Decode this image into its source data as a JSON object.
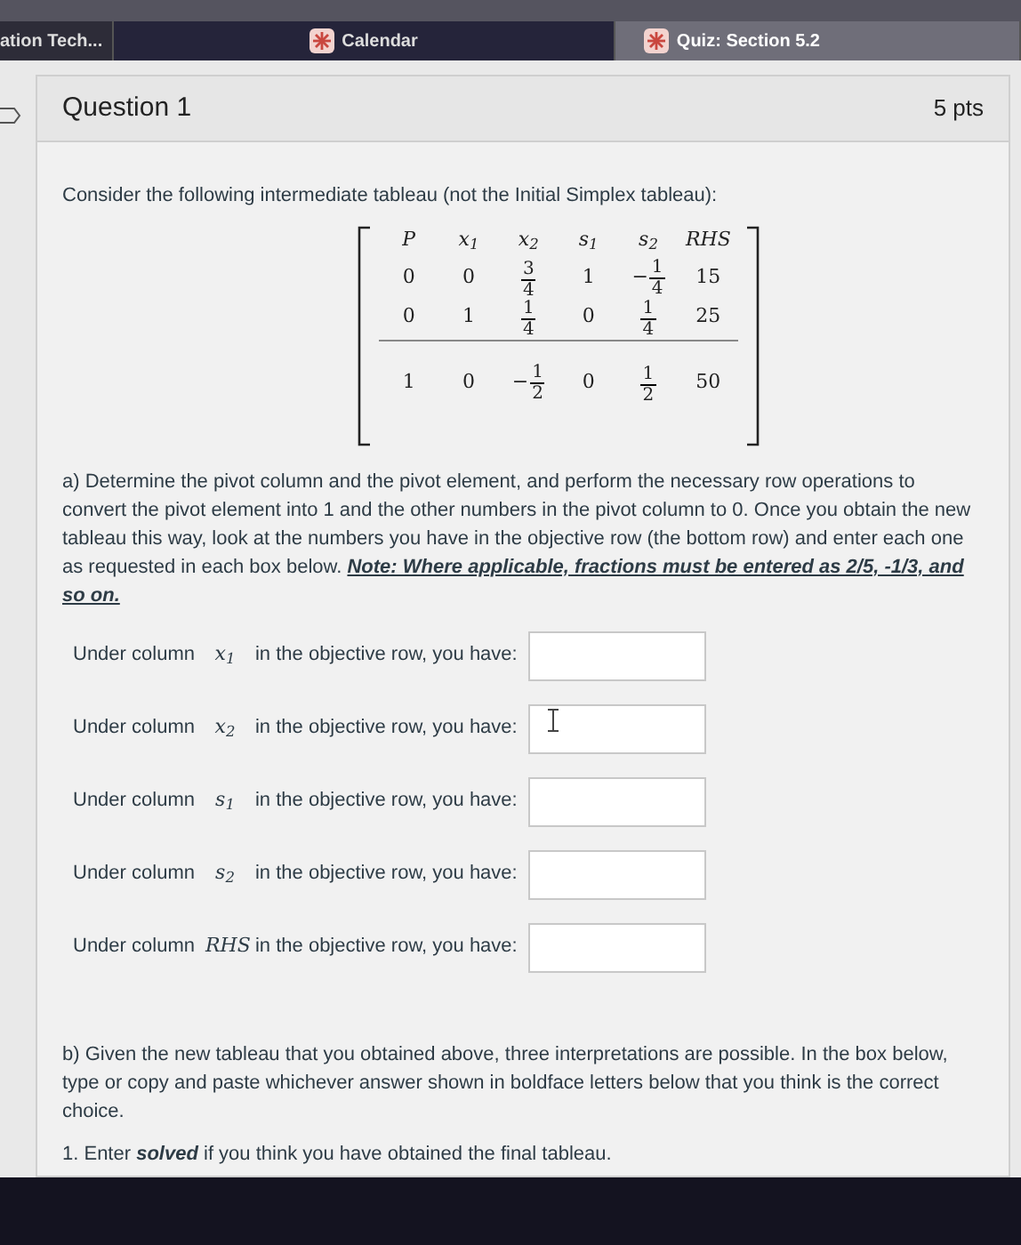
{
  "browser_tabs": [
    {
      "label": "ation Tech...",
      "selected": false,
      "icon": false
    },
    {
      "label": "Calendar",
      "selected": false,
      "icon": true
    },
    {
      "label": "Quiz: Section 5.2",
      "selected": true,
      "icon": true
    }
  ],
  "question": {
    "title": "Question 1",
    "points": "5 pts",
    "intro": "Consider the following intermediate tableau (not the Initial Simplex tableau):",
    "tableau": {
      "headers": [
        "P",
        "x$_{1}$",
        "x$_{2}$",
        "s$_{1}$",
        "s$_{2}$",
        "RHS"
      ],
      "rows": [
        [
          {
            "kind": "number",
            "text": "0"
          },
          {
            "kind": "number",
            "text": "0"
          },
          {
            "kind": "fraction",
            "numerator": "3",
            "denominator": "4"
          },
          {
            "kind": "number",
            "text": "1"
          },
          {
            "kind": "fraction",
            "sign": "−",
            "numerator": "1",
            "denominator": "4"
          },
          {
            "kind": "number",
            "text": "15"
          }
        ],
        [
          {
            "kind": "number",
            "text": "0"
          },
          {
            "kind": "number",
            "text": "1"
          },
          {
            "kind": "fraction",
            "numerator": "1",
            "denominator": "4"
          },
          {
            "kind": "number",
            "text": "0"
          },
          {
            "kind": "fraction",
            "numerator": "1",
            "denominator": "4"
          },
          {
            "kind": "number",
            "text": "25"
          }
        ]
      ],
      "objective_row": [
        {
          "kind": "number",
          "text": "1"
        },
        {
          "kind": "number",
          "text": "0"
        },
        {
          "kind": "fraction",
          "sign": "−",
          "numerator": "1",
          "denominator": "2"
        },
        {
          "kind": "number",
          "text": "0"
        },
        {
          "kind": "fraction",
          "numerator": "1",
          "denominator": "2"
        },
        {
          "kind": "number",
          "text": "50"
        }
      ]
    },
    "part_a": "a) Determine the pivot column and the pivot element, and perform the necessary row operations to convert the pivot element into 1 and the other numbers in the pivot column to 0. Once you obtain the new tableau this way, look at the numbers you have in the objective row (the bottom row) and enter each one as requested in each box below.",
    "part_a_note": "Note: Where applicable, fractions must be entered as 2/5,  -1/3, and so on.",
    "answers": [
      {
        "prefix": "Under column",
        "variable": "x$_{1}$",
        "suffix": "in the objective row, you have:",
        "cursor": false
      },
      {
        "prefix": "Under column",
        "variable": "x$_{2}$",
        "suffix": "in the objective row, you have:",
        "cursor": true
      },
      {
        "prefix": "Under column",
        "variable": "s$_{1}$",
        "suffix": "in the objective row, you have:",
        "cursor": false
      },
      {
        "prefix": "Under column",
        "variable": "s$_{2}$",
        "suffix": "in the objective row, you have:",
        "cursor": false
      },
      {
        "prefix": "Under column",
        "variable": "RHS",
        "suffix": "in the objective row, you have:",
        "cursor": false
      }
    ],
    "part_b": "b) Given the new tableau that you obtained above, three interpretations are possible. In the box below, type or copy and paste whichever answer shown in boldface letters below that you think is the correct choice.",
    "options": [
      "1. Enter *solved* if you think you have obtained the final tableau."
    ]
  }
}
